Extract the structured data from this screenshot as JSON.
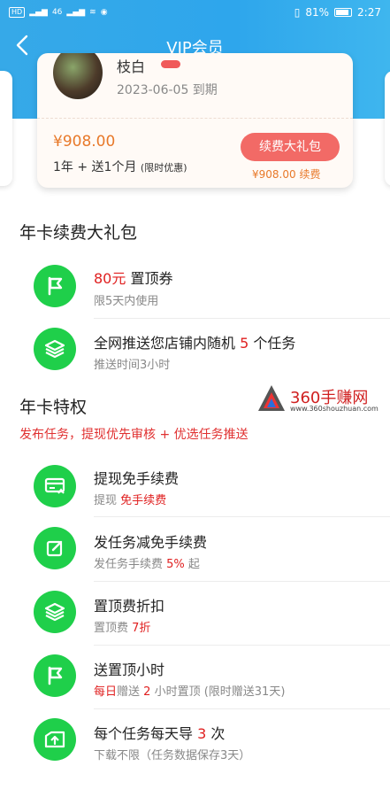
{
  "status_bar": {
    "left": [
      "HD",
      "4G",
      "46"
    ],
    "battery": "81%",
    "time": "2:27"
  },
  "nav": {
    "title": "VIP会员"
  },
  "vip_card": {
    "username": "枝白",
    "expire": "2023-06-05 到期",
    "price": "¥908.00",
    "plan_main": "1年 + 送1个月",
    "plan_note": "(限时优惠)",
    "renew_button": "续费大礼包",
    "renew_sub": "¥908.00 续费"
  },
  "gift_section": {
    "title": "年卡续费大礼包",
    "items": [
      {
        "icon": "flag-icon",
        "t1_prefix": "",
        "t1_highlight": "80元",
        "t1_suffix": " 置顶券",
        "t2_prefix": "限5天内使用",
        "t2_highlight": "",
        "t2_suffix": ""
      },
      {
        "icon": "layers-icon",
        "t1_prefix": "全网推送您店铺内随机 ",
        "t1_highlight": "5",
        "t1_suffix": " 个任务",
        "t2_prefix": "推送时间3小时",
        "t2_highlight": "",
        "t2_suffix": ""
      }
    ]
  },
  "privilege_section": {
    "title": "年卡特权",
    "note": "发布任务，提现优先审核 + 优选任务推送",
    "items": [
      {
        "icon": "card-icon",
        "t1_prefix": "提现免手续费",
        "t1_highlight": "",
        "t1_suffix": "",
        "t2_prefix": "提现 ",
        "t2_highlight": "免手续费",
        "t2_suffix": ""
      },
      {
        "icon": "edit-icon",
        "t1_prefix": "发任务减免手续费",
        "t1_highlight": "",
        "t1_suffix": "",
        "t2_prefix": "发任务手续费 ",
        "t2_highlight": "5%",
        "t2_suffix": " 起"
      },
      {
        "icon": "layers-icon",
        "t1_prefix": "置顶费折扣",
        "t1_highlight": "",
        "t1_suffix": "",
        "t2_prefix": "置顶费 ",
        "t2_highlight": "7折",
        "t2_suffix": ""
      },
      {
        "icon": "flag-icon",
        "t1_prefix": "送置顶小时",
        "t1_highlight": "",
        "t1_suffix": "",
        "t2_highlight_first": "每日",
        "t2_prefix": "赠送 ",
        "t2_highlight": "2",
        "t2_suffix": " 小时置顶 (限时赠送31天)"
      },
      {
        "icon": "upload-box-icon",
        "t1_prefix": "每个任务每天导 ",
        "t1_highlight": "3",
        "t1_suffix": " 次",
        "t2_prefix": "下载不限（任务数据保存3天）",
        "t2_highlight": "",
        "t2_suffix": ""
      }
    ]
  },
  "watermark": {
    "text": "360手赚网",
    "url": "www.360shouzhuan.com"
  }
}
